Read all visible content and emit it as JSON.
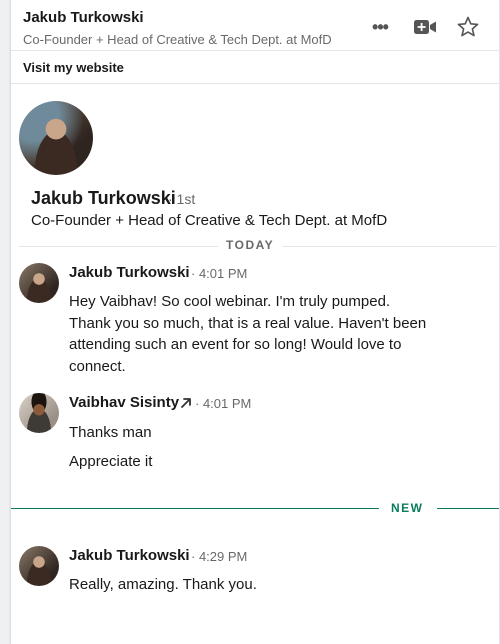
{
  "header": {
    "name": "Jakub Turkowski",
    "title": "Co-Founder + Head of Creative & Tech Dept. at MofD",
    "icons": [
      "more-icon",
      "video-icon",
      "star-icon"
    ]
  },
  "visit_link": "Visit my website",
  "profile": {
    "name": "Jakub Turkowski",
    "degree": "· 1st",
    "headline": "Co-Founder + Head of Creative & Tech Dept. at MofD"
  },
  "divider_today": "TODAY",
  "divider_new": "NEW",
  "accent_color": "#0a7c5c",
  "messages": [
    {
      "sender": "Jakub Turkowski",
      "time": "· 4:01 PM",
      "lines": [
        "Hey Vaibhav! So cool webinar. I'm truly pumped.",
        "Thank you so much, that is a real value. Haven't been",
        "attending such an event for so long! Would love to",
        "connect."
      ]
    },
    {
      "sender": "Vaibhav Sisinty",
      "time": "· 4:01 PM",
      "lines": [
        "Thanks man",
        "Appreciate it"
      ]
    },
    {
      "sender": "Jakub Turkowski",
      "time": "· 4:29 PM",
      "lines": [
        "Really, amazing. Thank you."
      ]
    }
  ]
}
